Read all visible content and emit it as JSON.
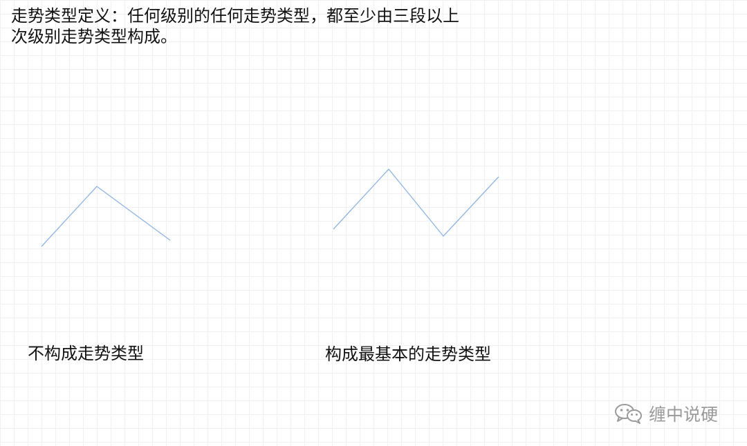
{
  "heading": {
    "line1": "走势类型定义：任何级别的任何走势类型，都至少由三段以上",
    "line2": "次级别走势类型构成。"
  },
  "diagrams": {
    "left_caption": "不构成走势类型",
    "right_caption": "构成最基本的走势类型",
    "line_color": "#8fb4e3"
  },
  "watermark": {
    "icon": "wechat-icon",
    "text": "缠中说硬"
  }
}
